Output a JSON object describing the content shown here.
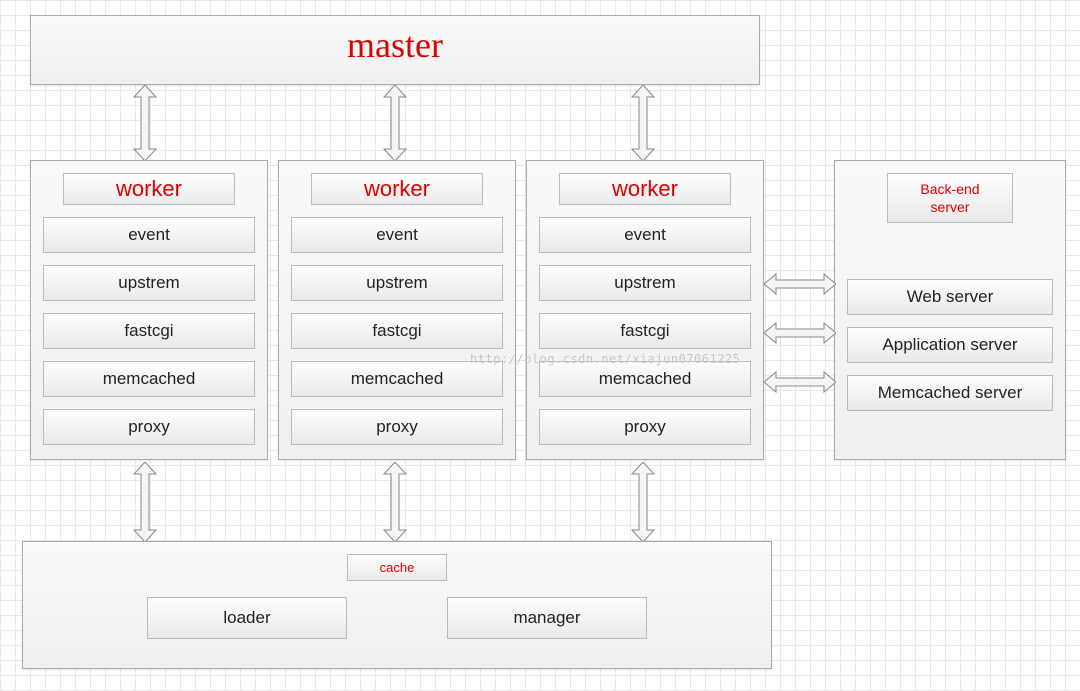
{
  "master": {
    "label": "master"
  },
  "workers": [
    {
      "title": "worker",
      "modules": [
        "event",
        "upstrem",
        "fastcgi",
        "memcached",
        "proxy"
      ]
    },
    {
      "title": "worker",
      "modules": [
        "event",
        "upstrem",
        "fastcgi",
        "memcached",
        "proxy"
      ]
    },
    {
      "title": "worker",
      "modules": [
        "event",
        "upstrem",
        "fastcgi",
        "memcached",
        "proxy"
      ]
    }
  ],
  "backend": {
    "title": "Back-end\nserver",
    "modules": [
      "Web server",
      "Application server",
      "Memcached server"
    ]
  },
  "cache": {
    "title": "cache",
    "modules": [
      "loader",
      "manager"
    ]
  },
  "watermark": "http://blog.csdn.net/xiajun07061225"
}
